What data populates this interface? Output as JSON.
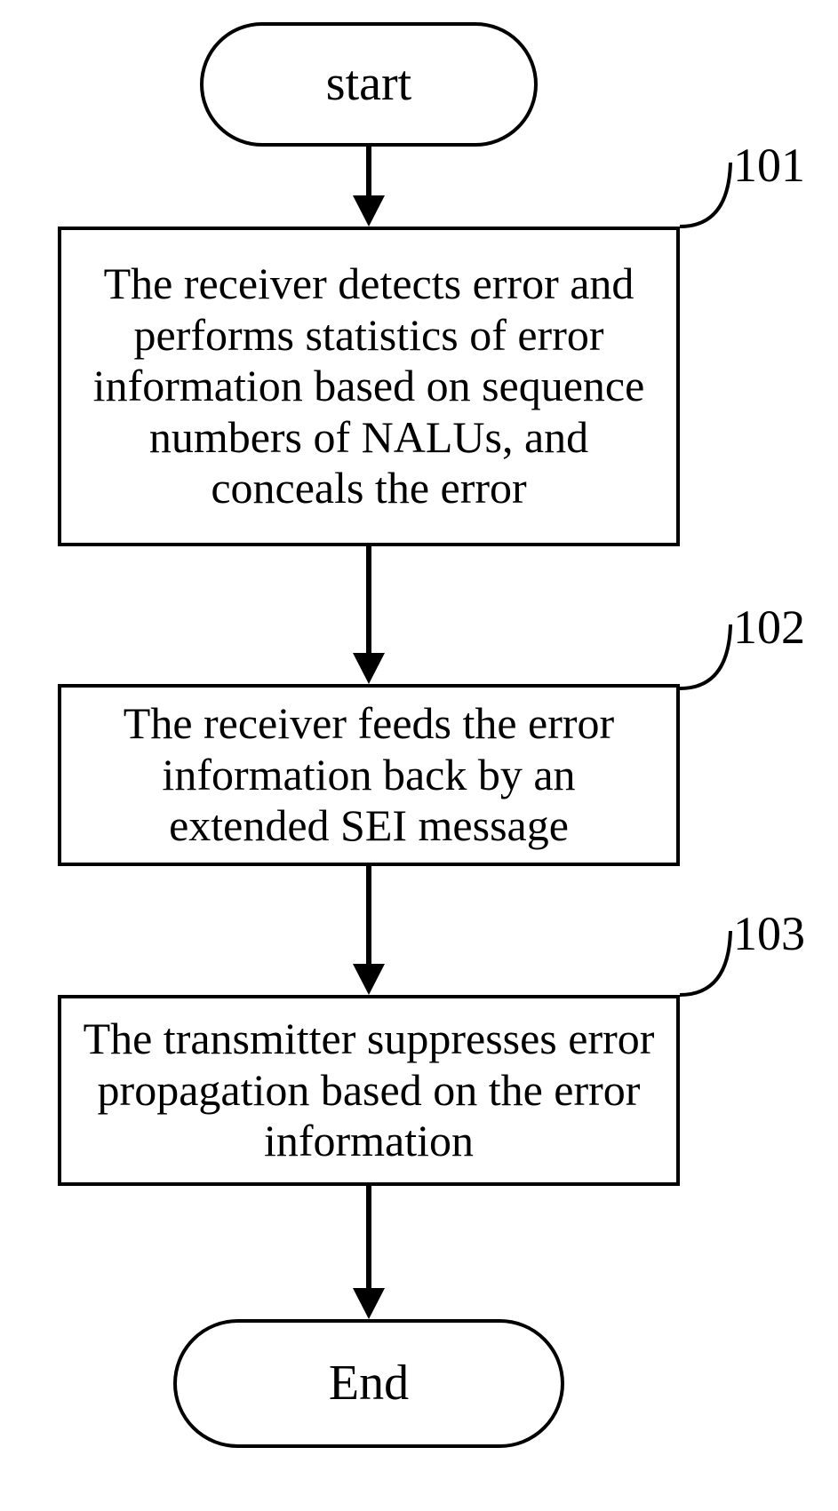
{
  "chart_data": {
    "type": "flowchart",
    "direction": "top-to-bottom",
    "nodes": [
      {
        "id": "start",
        "kind": "terminal",
        "text": "start"
      },
      {
        "id": "step101",
        "kind": "process",
        "label": "101",
        "text": "The receiver detects error and performs statistics of error information based on sequence numbers of NALUs, and conceals the error"
      },
      {
        "id": "step102",
        "kind": "process",
        "label": "102",
        "text": "The receiver feeds the error information back by an extended SEI message"
      },
      {
        "id": "step103",
        "kind": "process",
        "label": "103",
        "text": "The transmitter suppresses error propagation based on the error information"
      },
      {
        "id": "end",
        "kind": "terminal",
        "text": "End"
      }
    ],
    "edges": [
      {
        "from": "start",
        "to": "step101"
      },
      {
        "from": "step101",
        "to": "step102"
      },
      {
        "from": "step102",
        "to": "step103"
      },
      {
        "from": "step103",
        "to": "end"
      }
    ]
  },
  "start_text": "start",
  "step101_text": "The receiver detects error and performs statistics of error information based on sequence numbers of NALUs, and conceals the error",
  "step101_label": "101",
  "step102_text": "The receiver feeds the error information back by an extended SEI message",
  "step102_label": "102",
  "step103_text": "The transmitter suppresses error propagation based on the error information",
  "step103_label": "103",
  "end_text": "End"
}
